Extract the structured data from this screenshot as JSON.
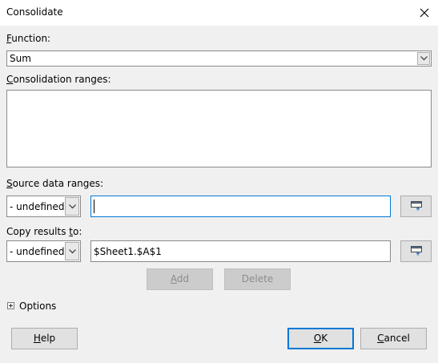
{
  "window": {
    "title": "Consolidate"
  },
  "function": {
    "label_first": "F",
    "label_rest": "unction:",
    "value": "Sum"
  },
  "consolidation_ranges": {
    "label_first": "C",
    "label_rest": "onsolidation ranges:",
    "items": []
  },
  "source": {
    "label_first": "S",
    "label_rest": "ource data ranges:",
    "select_value": "- undefined -",
    "input_value": ""
  },
  "copy_to": {
    "label_pre": "Copy results ",
    "label_u": "t",
    "label_rest": "o:",
    "select_value": "- undefined -",
    "input_value": "$Sheet1.$A$1"
  },
  "actions": {
    "add_u": "A",
    "add_rest": "dd",
    "delete_label": "Delete"
  },
  "options": {
    "label_first": "O",
    "label_rest": "ptions"
  },
  "footer": {
    "help_u": "H",
    "help_rest": "elp",
    "ok_u": "O",
    "ok_rest": "K",
    "cancel_u": "C",
    "cancel_rest": "ancel"
  },
  "icons": {
    "close": "close-icon",
    "dropdown": "chevron-down-icon",
    "shrink": "shrink-dialog-icon",
    "expand": "expand-plus-icon"
  },
  "colors": {
    "accent": "#0078d7",
    "dialog_bg": "#f0f0f0"
  }
}
